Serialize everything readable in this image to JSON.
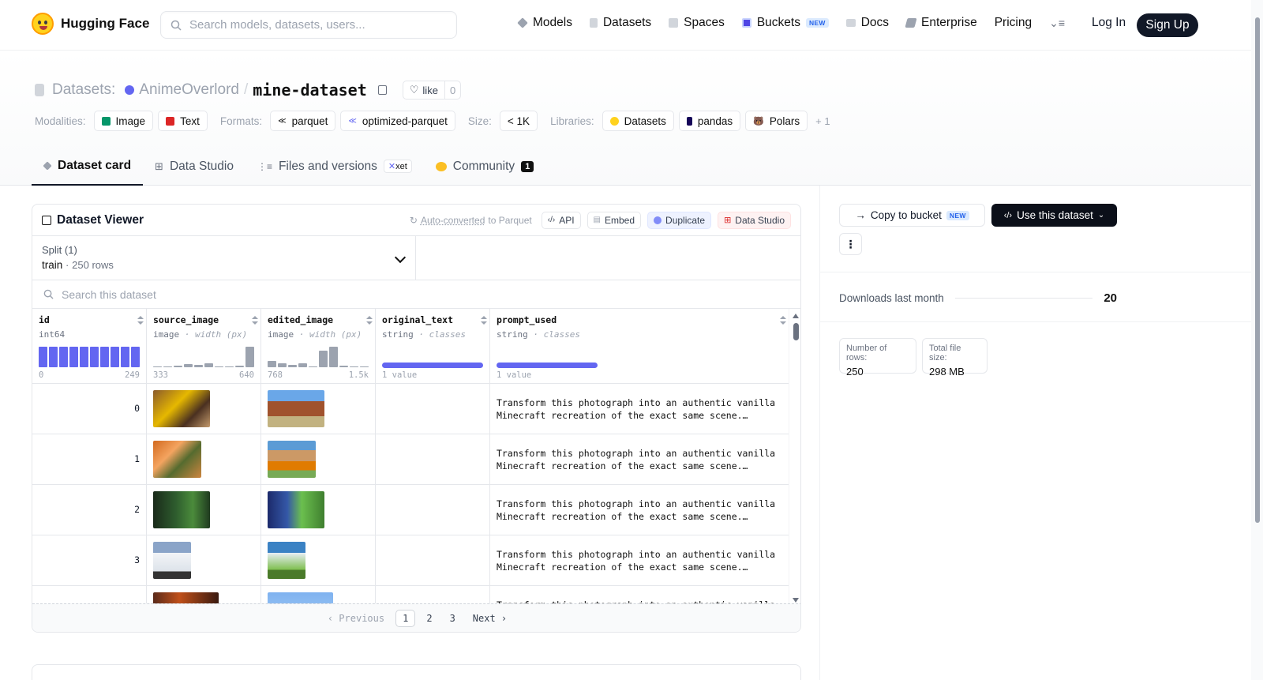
{
  "nav": {
    "brand": "Hugging Face",
    "search_placeholder": "Search models, datasets, users...",
    "links": [
      {
        "label": "Models",
        "icon": "cube-icon"
      },
      {
        "label": "Datasets",
        "icon": "database-icon"
      },
      {
        "label": "Spaces",
        "icon": "grid-icon"
      },
      {
        "label": "Buckets",
        "icon": "bucket-icon",
        "badge": "NEW"
      },
      {
        "label": "Docs",
        "icon": "book-icon"
      },
      {
        "label": "Enterprise",
        "icon": "enterprise-icon"
      },
      {
        "label": "Pricing"
      }
    ],
    "login": "Log In",
    "signup": "Sign Up"
  },
  "header": {
    "section_label": "Datasets:",
    "owner": "AnimeOverlord",
    "separator": "/",
    "name": "mine-dataset",
    "like_label": "like",
    "like_count": "0",
    "modalities_label": "Modalities:",
    "modalities": [
      "Image",
      "Text"
    ],
    "formats_label": "Formats:",
    "formats": [
      "parquet",
      "optimized-parquet"
    ],
    "size_label": "Size:",
    "size": "< 1K",
    "libraries_label": "Libraries:",
    "libraries": [
      "Datasets",
      "pandas",
      "Polars"
    ],
    "libraries_more": "+ 1"
  },
  "tabs": [
    {
      "label": "Dataset card",
      "active": true
    },
    {
      "label": "Data Studio"
    },
    {
      "label": "Files and versions",
      "badge": "xet"
    },
    {
      "label": "Community",
      "count": "1"
    }
  ],
  "viewer": {
    "title": "Dataset Viewer",
    "auto_converted_link": "Auto-converted",
    "auto_converted_suffix": "to Parquet",
    "buttons": [
      "API",
      "Embed",
      "Duplicate",
      "Data Studio"
    ],
    "split_label": "Split (1)",
    "split_value": "train",
    "split_dot": "·",
    "split_rows": "250 rows",
    "search_placeholder": "Search this dataset",
    "columns": [
      {
        "name": "id",
        "type": "int64",
        "subtype": "",
        "range_min": "0",
        "range_max": "249"
      },
      {
        "name": "source_image",
        "type": "image",
        "subtype": "· width (px)",
        "range_min": "333",
        "range_max": "640"
      },
      {
        "name": "edited_image",
        "type": "image",
        "subtype": "· width (px)",
        "range_min": "768",
        "range_max": "1.5k"
      },
      {
        "name": "original_text",
        "type": "string",
        "subtype": "· classes",
        "range_min": "1 value",
        "range_max": ""
      },
      {
        "name": "prompt_used",
        "type": "string",
        "subtype": "· classes",
        "range_min": "1 value",
        "range_max": ""
      }
    ],
    "rows": [
      {
        "id": "0",
        "prompt_line1": "Transform this photograph into an authentic vanilla",
        "prompt_line2": "Minecraft recreation of the exact same scene.…"
      },
      {
        "id": "1",
        "prompt_line1": "Transform this photograph into an authentic vanilla",
        "prompt_line2": "Minecraft recreation of the exact same scene.…"
      },
      {
        "id": "2",
        "prompt_line1": "Transform this photograph into an authentic vanilla",
        "prompt_line2": "Minecraft recreation of the exact same scene.…"
      },
      {
        "id": "3",
        "prompt_line1": "Transform this photograph into an authentic vanilla",
        "prompt_line2": "Minecraft recreation of the exact same scene.…"
      },
      {
        "id": "",
        "prompt_line1": "Transform this photograph into an authentic vanilla",
        "prompt_line2": ""
      }
    ],
    "pager": {
      "previous": "‹ Previous",
      "pages": [
        "1",
        "2",
        "3"
      ],
      "current": "1",
      "next": "Next ›"
    }
  },
  "sidebar": {
    "copy_bucket": "Copy to bucket",
    "copy_bucket_badge": "NEW",
    "use_dataset": "Use this dataset",
    "more": "⋮",
    "downloads_label": "Downloads last month",
    "downloads_value": "20",
    "rows_label": "Number of rows:",
    "rows_value": "250",
    "size_label": "Total file size:",
    "size_value": "298 MB"
  },
  "colors": {
    "accent": "#6366f1",
    "dark": "#111827"
  }
}
